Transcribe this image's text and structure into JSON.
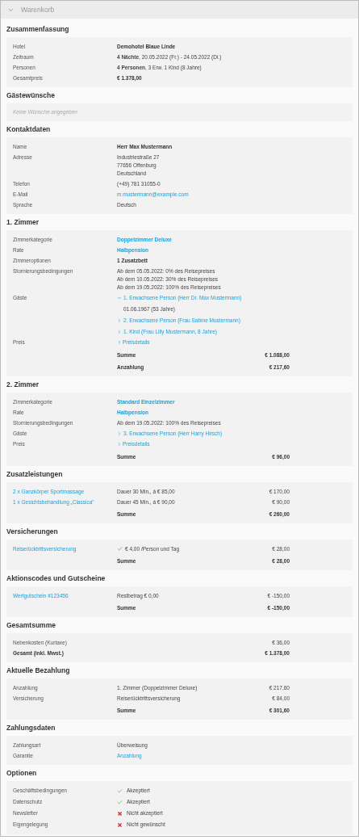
{
  "header": {
    "title": "Warenkorb"
  },
  "sections": [
    {
      "title": "Zusammenfassung",
      "rows": [
        {
          "kind": "bold_field",
          "label": "Hotel",
          "lines": [
            "Demohotel Blaue Linde"
          ]
        },
        {
          "kind": "field",
          "label": "Zeitraum",
          "lines": [
            "**4 Nächte**, 20.05.2022 (Fr.) - 24.05.2022 (Di.)"
          ]
        },
        {
          "kind": "field",
          "label": "Personen",
          "lines": [
            "**4 Personen**, 3 Erw. 1 Kind (8 Jahre)"
          ]
        },
        {
          "kind": "bold_field",
          "label": "Gesamtpreis",
          "lines": [
            "€ 1.378,00"
          ]
        }
      ]
    },
    {
      "title": "Gästewünsche",
      "rows": [
        {
          "kind": "note",
          "text": "Keine Wünsche angegeben"
        }
      ]
    },
    {
      "title": "Kontaktdaten",
      "rows": [
        {
          "kind": "bold_field",
          "label": "Name",
          "lines": [
            "Herr Max Mustermann"
          ]
        },
        {
          "kind": "field",
          "label": "Adresse",
          "lines": [
            "Industriestraße 27",
            "77656 Offenburg",
            "Deutschland"
          ]
        },
        {
          "kind": "field",
          "label": "Telefon",
          "lines": [
            "(+49) 781 31055-0"
          ]
        },
        {
          "kind": "link_field",
          "label": "E-Mail",
          "lines": [
            "m.mustermann@example.com"
          ]
        },
        {
          "kind": "field",
          "label": "Sprache",
          "lines": [
            "Deutsch"
          ]
        }
      ]
    },
    {
      "title": "1. Zimmer",
      "rows": [
        {
          "kind": "bold_link_field",
          "label": "Zimmerkategorie",
          "lines": [
            "Doppelzimmer Deluxe"
          ]
        },
        {
          "kind": "bold_link_field",
          "label": "Rate",
          "lines": [
            "Halbpension"
          ]
        },
        {
          "kind": "bold_field",
          "label": "Zimmeroptionen",
          "lines": [
            "1 Zusatzbett"
          ]
        },
        {
          "kind": "field",
          "label": "Stornierungsbedingungen",
          "lines": [
            "Ab dem 05.05.2022: 0% des Reisepreises",
            "Ab dem 10.05.2022: 30% des Reisepreises",
            "Ab dem 19.05.2022: 100% des Reisepreises"
          ]
        },
        {
          "kind": "guests",
          "label": "Gäste",
          "guests": [
            {
              "text": "1. Erwachsene Person (Herr Dr. Max Mustermann)",
              "expanded": true,
              "detail": "01.06.1967 (53 Jahre)"
            },
            {
              "text": "2. Erwachsene Person (Frau Sabine Mustermann)",
              "expanded": false
            },
            {
              "text": "1. Kind (Frau Lilly Mustermann, 8 Jahre)",
              "expanded": false
            }
          ]
        },
        {
          "kind": "details",
          "label": "Preis",
          "link": "Preisdetails"
        },
        {
          "kind": "total",
          "label": "Summe",
          "amount": "€ 1.088,00"
        },
        {
          "kind": "total",
          "label": "Anzahlung",
          "amount": "€ 217,60"
        }
      ]
    },
    {
      "title": "2. Zimmer",
      "rows": [
        {
          "kind": "bold_link_field",
          "label": "Zimmerkategorie",
          "lines": [
            "Standard Einzelzimmer"
          ]
        },
        {
          "kind": "bold_link_field",
          "label": "Rate",
          "lines": [
            "Halbpension"
          ]
        },
        {
          "kind": "field",
          "label": "Stornierungsbedingungen",
          "lines": [
            "Ab dem 19.05.2022: 100% des Reisepreises"
          ]
        },
        {
          "kind": "guests",
          "label": "Gäste",
          "guests": [
            {
              "text": "3. Erwachsene Person (Herr Harry Hirsch)",
              "expanded": false
            }
          ]
        },
        {
          "kind": "details",
          "label": "Preis",
          "link": "Preisdetails"
        },
        {
          "kind": "total",
          "label": "Summe",
          "amount": "€ 96,00"
        }
      ]
    },
    {
      "title": "Zusatzleistungen",
      "rows": [
        {
          "kind": "line",
          "label": "2 x Ganzkörper Sportmassage",
          "label_link": true,
          "value": "Dauer 30 Min., á € 85,00",
          "amount": "€ 170,00",
          "check": false,
          "emphasis": false
        },
        {
          "kind": "line",
          "label": "1 x Gesichtsbehandlung „Classica\"",
          "label_link": true,
          "value": "Dauer 45 Min., á € 90,00",
          "amount": "€ 90,00",
          "check": false,
          "emphasis": false
        },
        {
          "kind": "total",
          "label": "Summe",
          "amount": "€ 260,00"
        }
      ]
    },
    {
      "title": "Versicherungen",
      "rows": [
        {
          "kind": "line",
          "label": "Reiserücktrittsversicherung",
          "label_link": true,
          "value": "€ 4,00 /Person und Tag",
          "amount": "€ 28,00",
          "check": true,
          "emphasis": false
        },
        {
          "kind": "total",
          "label": "Summe",
          "amount": "€ 28,00"
        }
      ]
    },
    {
      "title": "Aktionscodes und Gutscheine",
      "rows": [
        {
          "kind": "line",
          "label": "Wertgutschein #123456",
          "label_link": true,
          "value": "Restbetrag € 0,00",
          "amount": "€ -150,00",
          "check": false,
          "emphasis": false
        },
        {
          "kind": "total",
          "label": "Summe",
          "amount": "€ -150,00"
        }
      ]
    },
    {
      "title": "Gesamtsumme",
      "rows": [
        {
          "kind": "line",
          "label": "Nebenkosten (Kurtaxe)",
          "label_link": false,
          "amount": "€ 36,00",
          "check": false,
          "emphasis": false
        },
        {
          "kind": "line",
          "label": "Gesamt (inkl. Mwst.)",
          "label_link": false,
          "amount": "€ 1.378,00",
          "check": false,
          "emphasis": true
        }
      ]
    },
    {
      "title": "Aktuelle Bezahlung",
      "rows": [
        {
          "kind": "line",
          "label": "Anzahlung",
          "label_link": false,
          "value": "1. Zimmer (Doppelzimmer Deluxe)",
          "amount": "€ 217,60",
          "check": false,
          "emphasis": false
        },
        {
          "kind": "line",
          "label": "Versicherung",
          "label_link": false,
          "value": "Reiserücktrittsversicherung",
          "amount": "€ 84,00",
          "check": false,
          "emphasis": false
        },
        {
          "kind": "total",
          "label": "Summe",
          "amount": "€ 301,60"
        }
      ]
    },
    {
      "title": "Zahlungsdaten",
      "rows": [
        {
          "kind": "field",
          "label": "Zahlungsart",
          "lines": [
            "Überweisung"
          ]
        },
        {
          "kind": "link_field",
          "label": "Garantie",
          "lines": [
            "Anzahlung"
          ]
        }
      ]
    },
    {
      "title": "Optionen",
      "rows": [
        {
          "kind": "status",
          "label": "Geschäftsbedingungen",
          "accepted": true,
          "text": "Akzeptiert"
        },
        {
          "kind": "status",
          "label": "Datenschutz",
          "accepted": true,
          "text": "Akzeptiert"
        },
        {
          "kind": "status",
          "label": "Newsletter",
          "accepted": false,
          "text": "Nicht akzeptiert"
        },
        {
          "kind": "status",
          "label": "Eigengelegung",
          "accepted": false,
          "text": "Nicht gewünscht"
        }
      ]
    }
  ]
}
